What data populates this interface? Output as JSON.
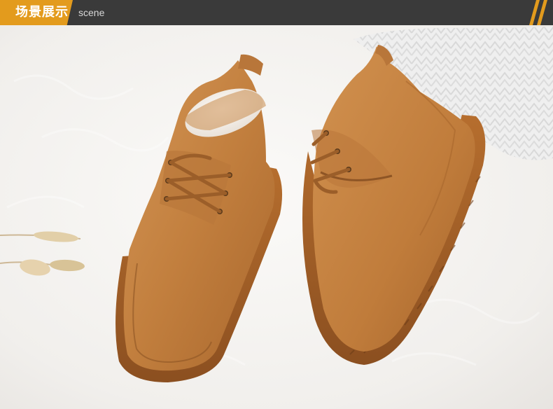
{
  "header": {
    "title_cn": "场景展示",
    "title_en": "scene"
  },
  "colors": {
    "accent": "#e39b1d",
    "bar": "#3a3a3a",
    "suede": "#c1803f",
    "suede_dark": "#8e5525",
    "fur": "#f3f0ec"
  },
  "icons": [
    "header-stripes-icon"
  ]
}
